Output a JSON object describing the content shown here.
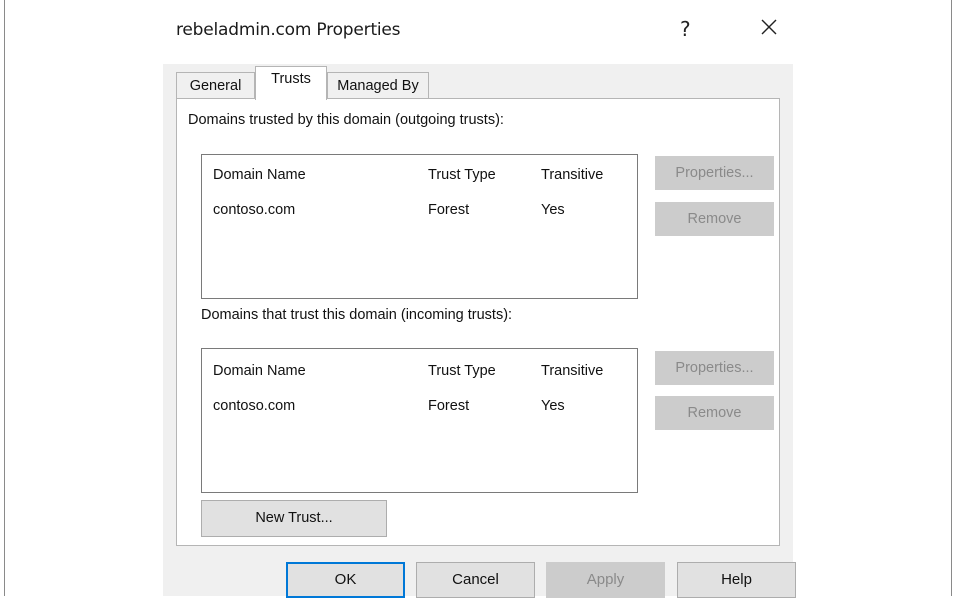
{
  "window": {
    "title": "rebeladmin.com Properties",
    "help_glyph": "?",
    "close_glyph": "close-icon"
  },
  "tabs": [
    {
      "label": "General",
      "active": false
    },
    {
      "label": "Trusts",
      "active": true
    },
    {
      "label": "Managed By",
      "active": false
    }
  ],
  "outgoing": {
    "label": "Domains trusted by this domain (outgoing trusts):",
    "columns": [
      "Domain Name",
      "Trust Type",
      "Transitive"
    ],
    "rows": [
      {
        "domain": "contoso.com",
        "type": "Forest",
        "transitive": "Yes"
      }
    ],
    "properties_label": "Properties...",
    "remove_label": "Remove"
  },
  "incoming": {
    "label": "Domains that trust this domain (incoming trusts):",
    "columns": [
      "Domain Name",
      "Trust Type",
      "Transitive"
    ],
    "rows": [
      {
        "domain": "contoso.com",
        "type": "Forest",
        "transitive": "Yes"
      }
    ],
    "properties_label": "Properties...",
    "remove_label": "Remove"
  },
  "new_trust_label": "New Trust...",
  "footer": {
    "ok": "OK",
    "cancel": "Cancel",
    "apply": "Apply",
    "help": "Help"
  },
  "colors": {
    "dialog_bg": "#f0f0f0",
    "panel_bg": "#ffffff",
    "disabled_button_bg": "#cccccc",
    "disabled_text": "#8a8a8a",
    "default_button_border": "#0078d7"
  }
}
